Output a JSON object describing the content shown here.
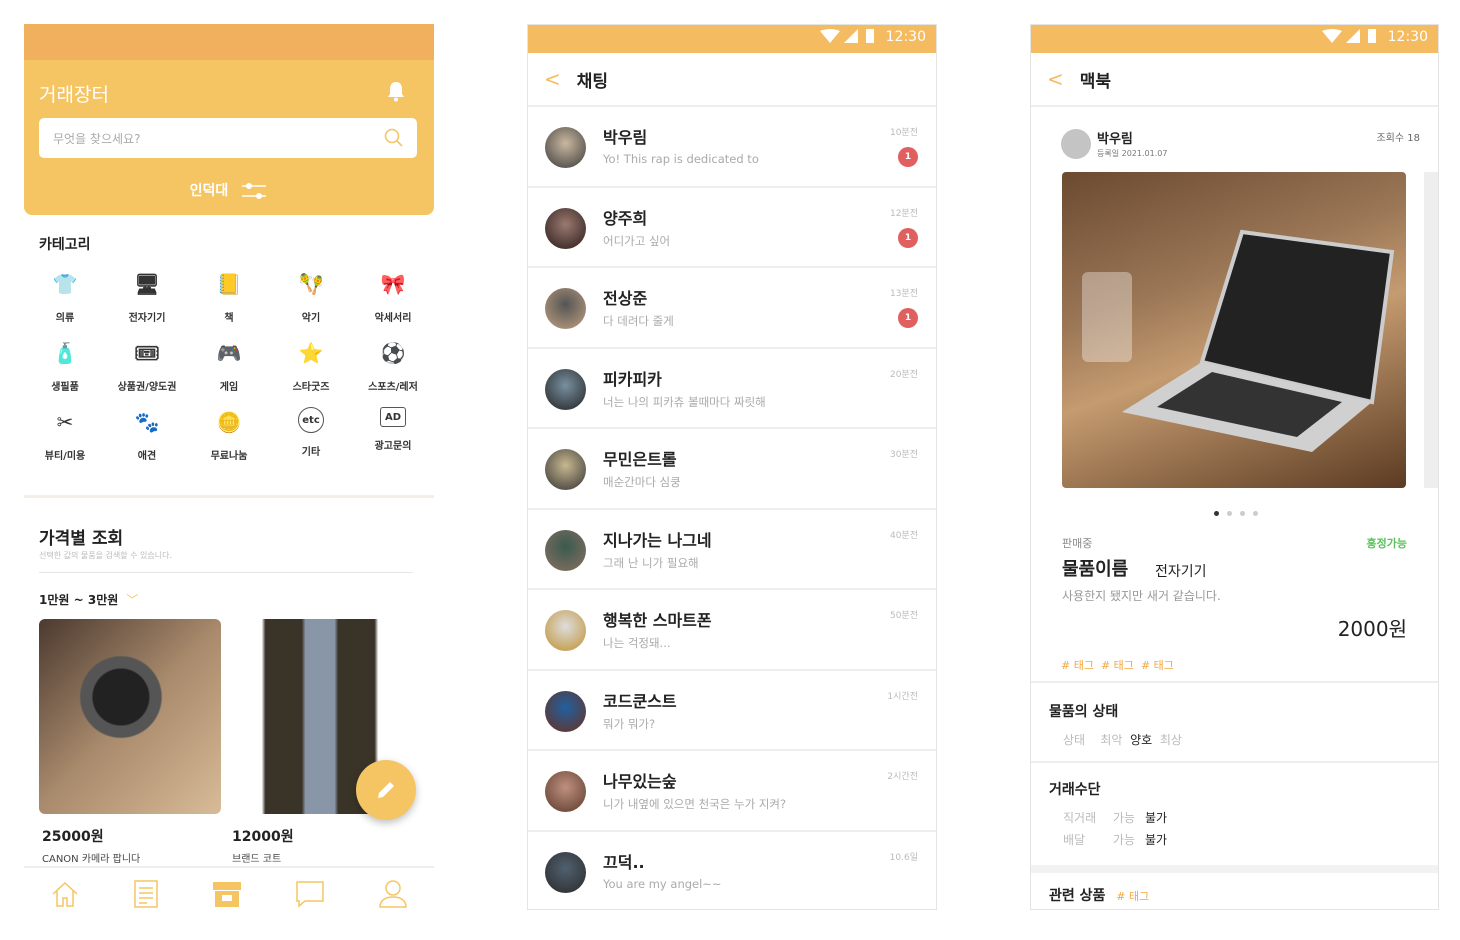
{
  "market": {
    "title": "거래장터",
    "search_placeholder": "무엇을 찾으세요?",
    "location": "인덕대",
    "category_title": "카테고리",
    "categories": [
      {
        "label": "의류",
        "icon": "shirt-icon"
      },
      {
        "label": "전자기기",
        "icon": "monitor-icon"
      },
      {
        "label": "책",
        "icon": "book-icon"
      },
      {
        "label": "악기",
        "icon": "instrument-icon"
      },
      {
        "label": "악세서리",
        "icon": "bow-icon"
      },
      {
        "label": "생필품",
        "icon": "pump-bottle-icon"
      },
      {
        "label": "상품권/양도권",
        "icon": "ticket-icon"
      },
      {
        "label": "게임",
        "icon": "gamepad-icon"
      },
      {
        "label": "스타굿즈",
        "icon": "star-icon"
      },
      {
        "label": "스포츠/레저",
        "icon": "soccer-ball-icon"
      },
      {
        "label": "뷰티/미용",
        "icon": "scissors-comb-icon"
      },
      {
        "label": "애견",
        "icon": "paw-icon"
      },
      {
        "label": "무료나눔",
        "icon": "coin-icon"
      },
      {
        "label": "기타",
        "icon": "etc-icon"
      },
      {
        "label": "광고문의",
        "icon": "ad-icon"
      }
    ],
    "price_title": "가격별 조회",
    "price_subtitle": "선택한 값의 물품을 검색할 수 있습니다.",
    "price_range": "1만원 ~ 3만원",
    "products": [
      {
        "price": "25000원",
        "name": "CANON 카메라 팝니다"
      },
      {
        "price": "12000원",
        "name": "브랜드 코트"
      }
    ],
    "nav": [
      "home-icon",
      "list-icon",
      "store-icon",
      "chat-icon",
      "profile-icon"
    ],
    "active_nav": "store-icon"
  },
  "chat": {
    "time": "12:30",
    "title": "채팅",
    "rows": [
      {
        "name": "박우림",
        "msg": "Yo! This rap is dedicated to",
        "time": "10분전",
        "unread": "1"
      },
      {
        "name": "양주희",
        "msg": "어디가고 싶어",
        "time": "12분전",
        "unread": "1"
      },
      {
        "name": "전상준",
        "msg": "다 데려다 줄게",
        "time": "13분전",
        "unread": "1"
      },
      {
        "name": "피카피카",
        "msg": "너는 나의 피카츄 볼때마다 짜릿해",
        "time": "20분전"
      },
      {
        "name": "무민은트롤",
        "msg": "매순간마다 심쿵",
        "time": "30분전"
      },
      {
        "name": "지나가는 나그네",
        "msg": "그래 난 니가 필요해",
        "time": "40분전"
      },
      {
        "name": "행복한 스마트폰",
        "msg": "나는 걱정돼...",
        "time": "50분전"
      },
      {
        "name": "코드쿤스트",
        "msg": "뭐가 뭐가?",
        "time": "1시간전"
      },
      {
        "name": "나무있는숲",
        "msg": "니가 내옆에 있으면 천국은 누가 지켜?",
        "time": "2시간전"
      },
      {
        "name": "끄덕..",
        "msg": "You are my angel~~",
        "time": "10.6일"
      }
    ]
  },
  "detail": {
    "time": "12:30",
    "title": "맥북",
    "author": "박우림",
    "date": "등록일 2021.01.07",
    "views": "조회수 18",
    "status": "판매중",
    "negotiable": "흥정가능",
    "item_name": "물품이름",
    "item_category": "전자기기",
    "description": "사용한지 됐지만 새거 같습니다.",
    "price": "2000원",
    "tags": [
      "# 태그",
      "# 태그",
      "# 태그"
    ],
    "image_count": 4,
    "image_index": 1,
    "condition_title": "물품의 상태",
    "condition_label": "상태",
    "condition_options": [
      "최악",
      "양호",
      "최상"
    ],
    "condition_selected": "양호",
    "trade_title": "거래수단",
    "trade_rows": [
      {
        "label": "직거래",
        "yes": "가능",
        "no": "불가",
        "selected": "불가"
      },
      {
        "label": "배달",
        "yes": "가능",
        "no": "불가",
        "selected": "불가"
      }
    ],
    "related_title": "관련 상품",
    "related_tag": "# 태그",
    "colors": {
      "accent": "#f6c563",
      "status": "#f4bb60",
      "tag": "#f4a640",
      "green": "#5cc35c",
      "badge": "#e06060"
    }
  }
}
